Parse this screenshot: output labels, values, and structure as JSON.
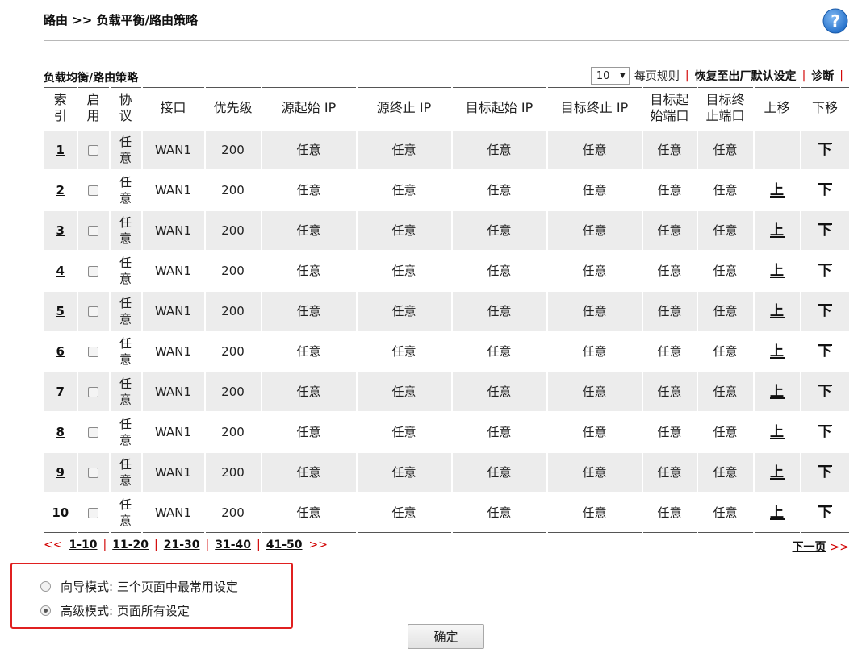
{
  "breadcrumb": "路由 >> 负载平衡/路由策略",
  "section_title": "负载均衡/路由策略",
  "controls": {
    "per_page_value": "10",
    "per_page_label": "每页规则",
    "restore_defaults": "恢复至出厂默认设定",
    "diagnose": "诊断"
  },
  "table": {
    "headers": {
      "index": [
        "索",
        "引"
      ],
      "enable": [
        "启",
        "用"
      ],
      "protocol": [
        "协",
        "议"
      ],
      "interface": "接口",
      "priority": "优先级",
      "src_start_ip": "源起始 IP",
      "src_end_ip": "源终止 IP",
      "dst_start_ip": "目标起始 IP",
      "dst_end_ip": "目标终止 IP",
      "dst_start_port": [
        "目标起",
        "始端口"
      ],
      "dst_end_port": [
        "目标终",
        "止端口"
      ],
      "move_up": "上移",
      "move_down": "下移"
    },
    "rows": [
      {
        "index": "1",
        "enabled": false,
        "protocol": [
          "任",
          "意"
        ],
        "interface": "WAN1",
        "priority": "200",
        "src_start": "任意",
        "src_end": "任意",
        "dst_start": "任意",
        "dst_end": "任意",
        "dport_start": "任意",
        "dport_end": "任意",
        "up": "",
        "down": "下"
      },
      {
        "index": "2",
        "enabled": false,
        "protocol": [
          "任",
          "意"
        ],
        "interface": "WAN1",
        "priority": "200",
        "src_start": "任意",
        "src_end": "任意",
        "dst_start": "任意",
        "dst_end": "任意",
        "dport_start": "任意",
        "dport_end": "任意",
        "up": "上",
        "down": "下"
      },
      {
        "index": "3",
        "enabled": false,
        "protocol": [
          "任",
          "意"
        ],
        "interface": "WAN1",
        "priority": "200",
        "src_start": "任意",
        "src_end": "任意",
        "dst_start": "任意",
        "dst_end": "任意",
        "dport_start": "任意",
        "dport_end": "任意",
        "up": "上",
        "down": "下"
      },
      {
        "index": "4",
        "enabled": false,
        "protocol": [
          "任",
          "意"
        ],
        "interface": "WAN1",
        "priority": "200",
        "src_start": "任意",
        "src_end": "任意",
        "dst_start": "任意",
        "dst_end": "任意",
        "dport_start": "任意",
        "dport_end": "任意",
        "up": "上",
        "down": "下"
      },
      {
        "index": "5",
        "enabled": false,
        "protocol": [
          "任",
          "意"
        ],
        "interface": "WAN1",
        "priority": "200",
        "src_start": "任意",
        "src_end": "任意",
        "dst_start": "任意",
        "dst_end": "任意",
        "dport_start": "任意",
        "dport_end": "任意",
        "up": "上",
        "down": "下"
      },
      {
        "index": "6",
        "enabled": false,
        "protocol": [
          "任",
          "意"
        ],
        "interface": "WAN1",
        "priority": "200",
        "src_start": "任意",
        "src_end": "任意",
        "dst_start": "任意",
        "dst_end": "任意",
        "dport_start": "任意",
        "dport_end": "任意",
        "up": "上",
        "down": "下"
      },
      {
        "index": "7",
        "enabled": false,
        "protocol": [
          "任",
          "意"
        ],
        "interface": "WAN1",
        "priority": "200",
        "src_start": "任意",
        "src_end": "任意",
        "dst_start": "任意",
        "dst_end": "任意",
        "dport_start": "任意",
        "dport_end": "任意",
        "up": "上",
        "down": "下"
      },
      {
        "index": "8",
        "enabled": false,
        "protocol": [
          "任",
          "意"
        ],
        "interface": "WAN1",
        "priority": "200",
        "src_start": "任意",
        "src_end": "任意",
        "dst_start": "任意",
        "dst_end": "任意",
        "dport_start": "任意",
        "dport_end": "任意",
        "up": "上",
        "down": "下"
      },
      {
        "index": "9",
        "enabled": false,
        "protocol": [
          "任",
          "意"
        ],
        "interface": "WAN1",
        "priority": "200",
        "src_start": "任意",
        "src_end": "任意",
        "dst_start": "任意",
        "dst_end": "任意",
        "dport_start": "任意",
        "dport_end": "任意",
        "up": "上",
        "down": "下"
      },
      {
        "index": "10",
        "enabled": false,
        "protocol": [
          "任",
          "意"
        ],
        "interface": "WAN1",
        "priority": "200",
        "src_start": "任意",
        "src_end": "任意",
        "dst_start": "任意",
        "dst_end": "任意",
        "dport_start": "任意",
        "dport_end": "任意",
        "up": "上",
        "down": "下"
      }
    ]
  },
  "pager": {
    "prev_arrows": "<<",
    "pages": [
      "1-10",
      "11-20",
      "21-30",
      "31-40",
      "41-50"
    ],
    "next_arrows": ">>",
    "next_page": "下一页"
  },
  "mode": {
    "wizard_label": "向导模式: 三个页面中最常用设定",
    "wizard_selected": false,
    "advanced_label": "高级模式: 页面所有设定",
    "advanced_selected": true
  },
  "ok_button": "确定",
  "colors": {
    "accent_red": "#d20000",
    "row_stripe": "#ececec",
    "help_icon": "#2b78d4"
  }
}
